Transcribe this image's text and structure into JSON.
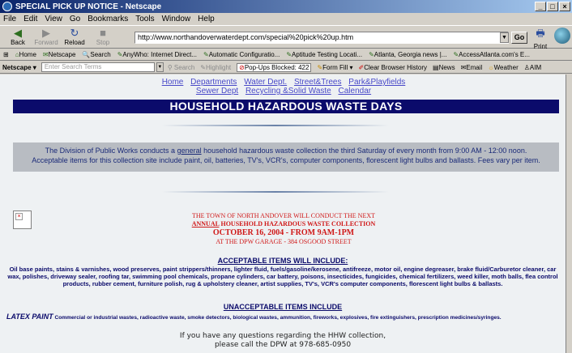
{
  "window": {
    "title": "SPECIAL PICK UP NOTICE - Netscape"
  },
  "menu": [
    "File",
    "Edit",
    "View",
    "Go",
    "Bookmarks",
    "Tools",
    "Window",
    "Help"
  ],
  "toolbar": {
    "back": "Back",
    "forward": "Forward",
    "reload": "Reload",
    "stop": "Stop",
    "url": "http://www.northandoverwaterdept.com/special%20pick%20up.htm",
    "go": "Go",
    "print": "Print"
  },
  "bookmarks": [
    "Home",
    "Netscape",
    "Search",
    "AnyWho: Internet Direct...",
    "Automatic Configuratio...",
    "Aptitude Testing Locati...",
    "Atlanta, Georgia news |...",
    "AccessAtlanta.com's E..."
  ],
  "searchbar": {
    "netscape": "Netscape",
    "placeholder": "Enter Search Terms",
    "search": "Search",
    "highlight": "Highlight",
    "popups": "Pop-Ups Blocked: 422",
    "formfill": "Form Fill",
    "clear": "Clear Browser History",
    "news": "News",
    "email": "Email",
    "weather": "Weather",
    "aim": "AIM"
  },
  "nav": {
    "row1": [
      "Home",
      "Departments",
      "Water Dept.",
      "Street&Trees",
      "Park&Playfields"
    ],
    "row2": [
      "Sewer Dept",
      "Recycling &Solid Waste",
      "Calendar"
    ]
  },
  "banner": "HOUSEHOLD HAZARDOUS WASTE DAYS",
  "intro": {
    "pre": "The Division of Public Works conducts a ",
    "u": "general",
    "post": " household hazardous waste collection the third Saturday of every month from 9:00 AM - 12:00 noon.  Acceptable items for this collection site include paint, oil, batteries, TV's, VCR's, computer components, florescent light bulbs and ballasts. Fees vary per item."
  },
  "notice": {
    "line1": "THE TOWN OF NORTH ANDOVER WILL CONDUCT THE NEXT",
    "line2u": "ANNUAL",
    "line2": " HOUSEHOLD HAZARDOUS WASTE COLLECTION",
    "line3": "OCTOBER 16, 2004 - FROM 9AM-1PM",
    "line4": "AT THE DPW GARAGE - 384 OSGOOD STREET"
  },
  "acceptable": {
    "heading": "ACCEPTABLE ITEMS WILL INCLUDE:",
    "body": "Oil base paints, stains & varnishes, wood preserves, paint strippers/thinners, lighter fluid, fuels/gasoline/kerosene, antifreeze, motor oil, engine degreaser, brake fluid/Carburetor cleaner, car wax, polishes, driveway sealer, roofing tar, swimming pool chemicals, propane cylinders, car battery, poisons, insecticides, fungicides, chemical fertilizers, weed killer, moth balls, flea control products, rubber cement, furniture polish, rug & upholstery cleaner, artist supplies, TV's, VCR's computer components, florescent light bulbs & ballasts."
  },
  "unacceptable": {
    "heading": "UNACCEPTABLE ITEMS INCLUDE",
    "lead": "LATEX PAINT",
    "body": " Commercial or industrial wastes, radioactive waste, smoke detectors, biological wastes, ammunition, fireworks, explosives, fire extinguishers, prescription medicines/syringes."
  },
  "contact": {
    "line1": "If you have any questions regarding the HHW collection,",
    "line2": "please call the DPW at 978-685-0950"
  }
}
